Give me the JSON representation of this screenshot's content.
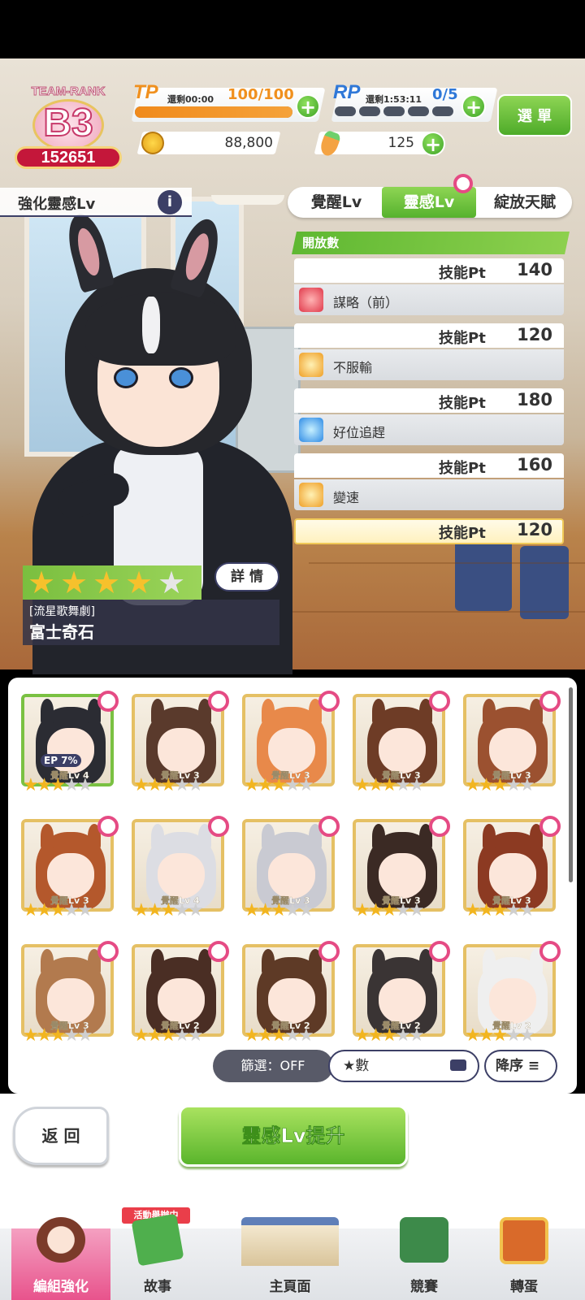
{
  "header": {
    "team_rank_label": "TEAM-RANK",
    "grade": "B3",
    "score": "152651",
    "tp": {
      "label": "TP",
      "recover_text": "還剩00:00",
      "value": "100/100",
      "fill_fraction": 1.0
    },
    "rp": {
      "label": "RP",
      "recover_text": "還剩1:53:11",
      "value": "0/5",
      "filled_segments": 0,
      "total_segments": 5
    },
    "menu_label": "選 單",
    "coins": "88,800",
    "carrots": "125"
  },
  "enhance": {
    "title": "強化靈感Lv",
    "info_label": "i"
  },
  "tabs": [
    {
      "label": "覺醒Lv",
      "active": false
    },
    {
      "label": "靈感Lv",
      "active": true
    },
    {
      "label": "綻放天賦",
      "active": false
    }
  ],
  "skills_header": "開放數",
  "skills": [
    {
      "pt_label": "技能Pt",
      "pt": "140",
      "name": "謀略（前）",
      "icon": "strategy-icon"
    },
    {
      "pt_label": "技能Pt",
      "pt": "120",
      "name": "不服輸",
      "icon": "runner-icon"
    },
    {
      "pt_label": "技能Pt",
      "pt": "180",
      "name": "好位追趕",
      "icon": "sparkle-icon"
    },
    {
      "pt_label": "技能Pt",
      "pt": "160",
      "name": "變速",
      "icon": "runner-icon"
    },
    {
      "pt_label": "技能Pt",
      "pt": "120",
      "name": "",
      "icon": ""
    }
  ],
  "character": {
    "rarity_stars": 4,
    "max_stars": 5,
    "detail_label": "詳 情",
    "subtitle": "[流星歌舞劇]",
    "name": "富士奇石"
  },
  "roster": [
    {
      "lv": "覺醒Lv 4",
      "stars": 3,
      "selected": true,
      "ep": "EP 7%",
      "hair": "#2b2c33"
    },
    {
      "lv": "覺醒Lv 3",
      "stars": 3,
      "selected": false,
      "hair": "#5a3a2c"
    },
    {
      "lv": "覺醒Lv 3",
      "stars": 3,
      "selected": false,
      "hair": "#e8894a"
    },
    {
      "lv": "覺醒Lv 3",
      "stars": 3,
      "selected": false,
      "hair": "#6e3c26"
    },
    {
      "lv": "覺醒Lv 3",
      "stars": 3,
      "selected": false,
      "hair": "#9b5130"
    },
    {
      "lv": "覺醒Lv 3",
      "stars": 3,
      "selected": false,
      "hair": "#b4582c"
    },
    {
      "lv": "覺醒Lv 4",
      "stars": 3,
      "selected": false,
      "hair": "#dcdde3"
    },
    {
      "lv": "覺醒Lv 3",
      "stars": 3,
      "selected": false,
      "hair": "#c9cad2"
    },
    {
      "lv": "覺醒Lv 3",
      "stars": 3,
      "selected": false,
      "hair": "#3b2a24"
    },
    {
      "lv": "覺醒Lv 3",
      "stars": 3,
      "selected": false,
      "hair": "#8c3a22"
    },
    {
      "lv": "覺醒Lv 3",
      "stars": 3,
      "selected": false,
      "hair": "#b27a4e"
    },
    {
      "lv": "覺醒Lv 2",
      "stars": 3,
      "selected": false,
      "hair": "#4a2e24"
    },
    {
      "lv": "覺醒Lv 2",
      "stars": 3,
      "selected": false,
      "hair": "#5e3a26"
    },
    {
      "lv": "覺醒Lv 2",
      "stars": 3,
      "selected": false,
      "hair": "#3a3434"
    },
    {
      "lv": "覺醒Lv 2",
      "stars": 3,
      "selected": false,
      "hair": "#efefef"
    }
  ],
  "filter": {
    "filter_label": "篩選：OFF",
    "sort_field": "★數",
    "sort_dir": "降序"
  },
  "actions": {
    "back_label": "返 回",
    "upgrade_label": "靈感Lv提升"
  },
  "nav": [
    {
      "label": "編組強化",
      "active": true,
      "icon": "team-icon"
    },
    {
      "label": "故事",
      "active": false,
      "icon": "story-book-icon",
      "tag": "活動舉辦中"
    },
    {
      "label": "主頁面",
      "active": false,
      "icon": "home-building-icon"
    },
    {
      "label": "競賽",
      "active": false,
      "icon": "race-icon"
    },
    {
      "label": "轉蛋",
      "active": false,
      "icon": "gacha-icon"
    }
  ],
  "colors": {
    "accent_green": "#5ab52c",
    "accent_pink": "#e8538c",
    "tp_orange": "#f08a1c"
  }
}
